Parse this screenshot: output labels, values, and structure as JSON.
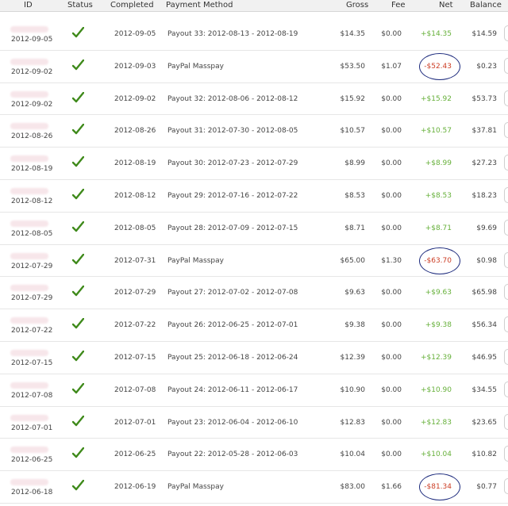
{
  "colors": {
    "positive": "#66b03a",
    "negative": "#cc3d24",
    "circle": "#1d2b7d",
    "check": "#3f8a1b"
  },
  "headers": {
    "id": "ID",
    "status": "Status",
    "completed": "Completed",
    "payment": "Payment Method",
    "gross": "Gross",
    "fee": "Fee",
    "net": "Net",
    "balance": "Balance"
  },
  "rows": [
    {
      "id_date": "2012-09-05",
      "completed": "2012-09-05",
      "payment": "Payout 33: 2012-08-13 - 2012-08-19",
      "gross": "$14.35",
      "fee": "$0.00",
      "net": "+$14.35",
      "balance": "$14.59",
      "status_icon": "check-icon"
    },
    {
      "id_date": "2012-09-02",
      "completed": "2012-09-03",
      "payment": "PayPal Masspay",
      "gross": "$53.50",
      "fee": "$1.07",
      "net": "-$52.43",
      "balance": "$0.23",
      "status_icon": "check-icon"
    },
    {
      "id_date": "2012-09-02",
      "completed": "2012-09-02",
      "payment": "Payout 32: 2012-08-06 - 2012-08-12",
      "gross": "$15.92",
      "fee": "$0.00",
      "net": "+$15.92",
      "balance": "$53.73",
      "status_icon": "check-icon"
    },
    {
      "id_date": "2012-08-26",
      "completed": "2012-08-26",
      "payment": "Payout 31: 2012-07-30 - 2012-08-05",
      "gross": "$10.57",
      "fee": "$0.00",
      "net": "+$10.57",
      "balance": "$37.81",
      "status_icon": "check-icon"
    },
    {
      "id_date": "2012-08-19",
      "completed": "2012-08-19",
      "payment": "Payout 30: 2012-07-23 - 2012-07-29",
      "gross": "$8.99",
      "fee": "$0.00",
      "net": "+$8.99",
      "balance": "$27.23",
      "status_icon": "check-icon"
    },
    {
      "id_date": "2012-08-12",
      "completed": "2012-08-12",
      "payment": "Payout 29: 2012-07-16 - 2012-07-22",
      "gross": "$8.53",
      "fee": "$0.00",
      "net": "+$8.53",
      "balance": "$18.23",
      "status_icon": "check-icon"
    },
    {
      "id_date": "2012-08-05",
      "completed": "2012-08-05",
      "payment": "Payout 28: 2012-07-09 - 2012-07-15",
      "gross": "$8.71",
      "fee": "$0.00",
      "net": "+$8.71",
      "balance": "$9.69",
      "status_icon": "check-icon"
    },
    {
      "id_date": "2012-07-29",
      "completed": "2012-07-31",
      "payment": "PayPal Masspay",
      "gross": "$65.00",
      "fee": "$1.30",
      "net": "-$63.70",
      "balance": "$0.98",
      "status_icon": "check-icon"
    },
    {
      "id_date": "2012-07-29",
      "completed": "2012-07-29",
      "payment": "Payout 27: 2012-07-02 - 2012-07-08",
      "gross": "$9.63",
      "fee": "$0.00",
      "net": "+$9.63",
      "balance": "$65.98",
      "status_icon": "check-icon"
    },
    {
      "id_date": "2012-07-22",
      "completed": "2012-07-22",
      "payment": "Payout 26: 2012-06-25 - 2012-07-01",
      "gross": "$9.38",
      "fee": "$0.00",
      "net": "+$9.38",
      "balance": "$56.34",
      "status_icon": "check-icon"
    },
    {
      "id_date": "2012-07-15",
      "completed": "2012-07-15",
      "payment": "Payout 25: 2012-06-18 - 2012-06-24",
      "gross": "$12.39",
      "fee": "$0.00",
      "net": "+$12.39",
      "balance": "$46.95",
      "status_icon": "check-icon"
    },
    {
      "id_date": "2012-07-08",
      "completed": "2012-07-08",
      "payment": "Payout 24: 2012-06-11 - 2012-06-17",
      "gross": "$10.90",
      "fee": "$0.00",
      "net": "+$10.90",
      "balance": "$34.55",
      "status_icon": "check-icon"
    },
    {
      "id_date": "2012-07-01",
      "completed": "2012-07-01",
      "payment": "Payout 23: 2012-06-04 - 2012-06-10",
      "gross": "$12.83",
      "fee": "$0.00",
      "net": "+$12.83",
      "balance": "$23.65",
      "status_icon": "check-icon"
    },
    {
      "id_date": "2012-06-25",
      "completed": "2012-06-25",
      "payment": "Payout 22: 2012-05-28 - 2012-06-03",
      "gross": "$10.04",
      "fee": "$0.00",
      "net": "+$10.04",
      "balance": "$10.82",
      "status_icon": "check-icon"
    },
    {
      "id_date": "2012-06-18",
      "completed": "2012-06-19",
      "payment": "PayPal Masspay",
      "gross": "$83.00",
      "fee": "$1.66",
      "net": "-$81.34",
      "balance": "$0.77",
      "status_icon": "check-icon"
    }
  ]
}
